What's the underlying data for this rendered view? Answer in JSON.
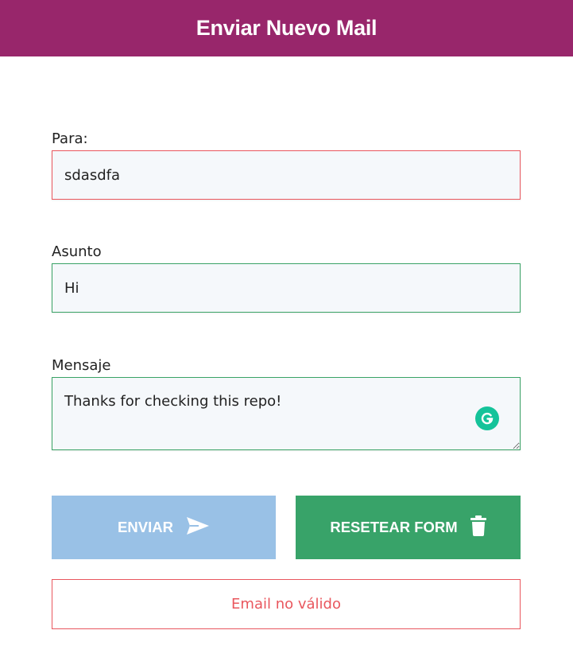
{
  "header": {
    "title": "Enviar Nuevo Mail"
  },
  "form": {
    "to": {
      "label": "Para:",
      "value": "sdasdfa",
      "status": "invalid"
    },
    "subject": {
      "label": "Asunto",
      "value": "Hi",
      "status": "valid"
    },
    "message": {
      "label": "Mensaje",
      "value": "Thanks for checking this repo!",
      "status": "valid"
    }
  },
  "buttons": {
    "send": {
      "label": "ENVIAR",
      "icon": "paper-plane-icon"
    },
    "reset": {
      "label": "RESETEAR FORM",
      "icon": "trash-icon"
    }
  },
  "error": {
    "message": "Email no válido"
  },
  "colors": {
    "header_bg": "#98266b",
    "invalid": "#e9575e",
    "valid": "#3aa366",
    "send_button": "#99c1e6",
    "reset_button": "#38a369"
  }
}
